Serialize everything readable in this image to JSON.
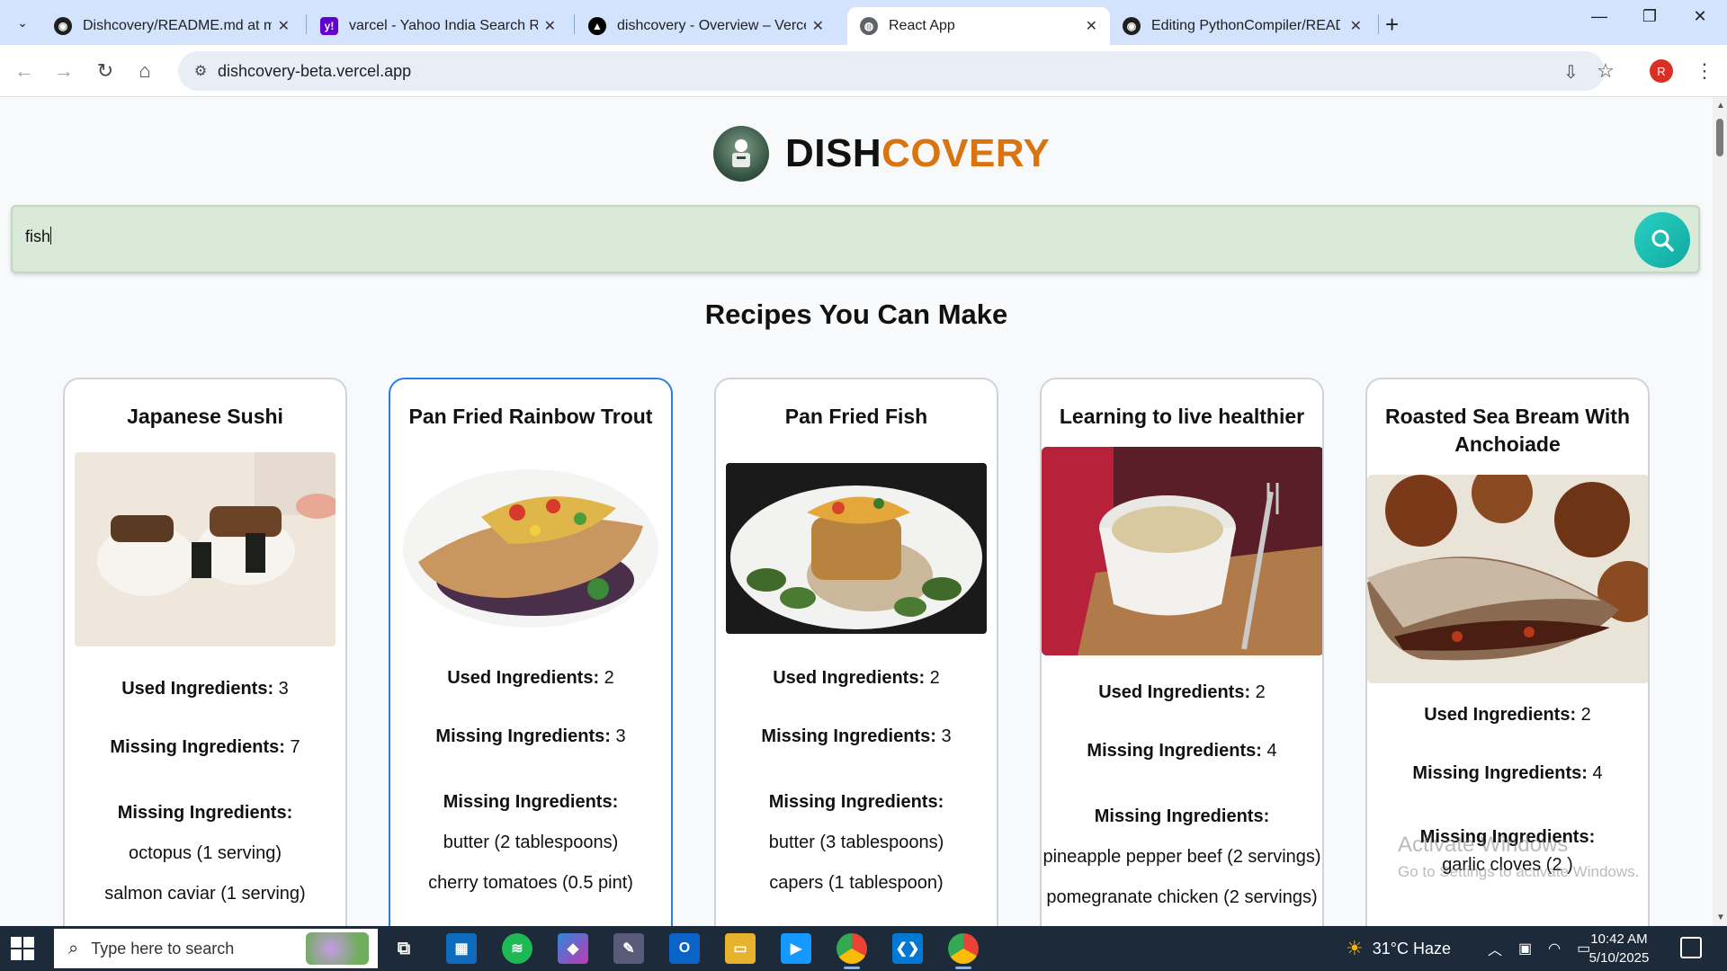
{
  "browser": {
    "tabs": [
      {
        "title": "Dishcovery/README.md at main",
        "favicon": "github-icon"
      },
      {
        "title": "varcel - Yahoo India Search Results",
        "favicon": "yahoo-icon"
      },
      {
        "title": "dishcovery - Overview – Vercel",
        "favicon": "vercel-icon"
      },
      {
        "title": "React App",
        "favicon": "globe-icon",
        "active": true
      },
      {
        "title": "Editing PythonCompiler/README.md",
        "favicon": "github-icon"
      }
    ],
    "url": "dishcovery-beta.vercel.app",
    "profile_initial": "R"
  },
  "app": {
    "brand_part1": "DISH",
    "brand_part2": "COVERY",
    "brand_accent_color": "#d9740f",
    "search_value": "fish",
    "section_title": "Recipes You Can Make",
    "used_label": "Used Ingredients:",
    "missing_count_label": "Missing Ingredients:",
    "missing_list_label": "Missing Ingredients:",
    "recipes": [
      {
        "title": "Japanese Sushi",
        "used": "3",
        "missing": "7",
        "missing_items": [
          "octopus (1 serving)",
          "salmon caviar (1 serving)"
        ]
      },
      {
        "title": "Pan Fried Rainbow Trout",
        "used": "2",
        "missing": "3",
        "missing_items": [
          "butter (2 tablespoons)",
          "cherry tomatoes (0.5 pint)"
        ]
      },
      {
        "title": "Pan Fried Fish",
        "used": "2",
        "missing": "3",
        "missing_items": [
          "butter (3 tablespoons)",
          "capers (1 tablespoon)"
        ]
      },
      {
        "title": "Learning to live healthier",
        "used": "2",
        "missing": "4",
        "missing_items": [
          "pineapple pepper beef (2 servings)",
          "pomegranate chicken (2 servings)"
        ]
      },
      {
        "title": "Roasted Sea Bream With Anchoiade",
        "used": "2",
        "missing": "4",
        "missing_items": [
          "garlic cloves (2 )"
        ]
      }
    ],
    "watermark_line1": "Activate Windows",
    "watermark_line2": "Go to Settings to activate Windows."
  },
  "taskbar": {
    "search_placeholder": "Type here to search",
    "weather": "31°C  Haze",
    "time": "10:42 AM",
    "date": "5/10/2025"
  }
}
